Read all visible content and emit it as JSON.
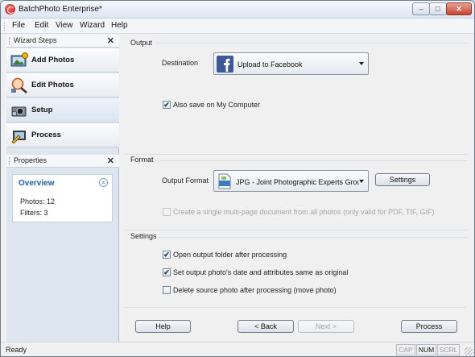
{
  "window": {
    "title": "BatchPhoto Enterprise*",
    "controls": {
      "minimize": "–",
      "maximize": "□",
      "close": "✕"
    }
  },
  "menu": [
    "File",
    "Edit",
    "View",
    "Wizard",
    "Help"
  ],
  "wizard_steps": {
    "title": "Wizard Steps",
    "close": "✕",
    "items": [
      {
        "label": "Add Photos",
        "icon": "add-photos-icon"
      },
      {
        "label": "Edit Photos",
        "icon": "edit-photos-icon"
      },
      {
        "label": "Setup",
        "icon": "setup-icon"
      },
      {
        "label": "Process",
        "icon": "process-icon"
      }
    ],
    "active": "Setup"
  },
  "properties": {
    "title": "Properties",
    "close": "✕",
    "overview": {
      "title": "Overview",
      "collapse": "»",
      "photos": "Photos: 12",
      "filters": "Filters: 3"
    }
  },
  "output": {
    "group_title": "Output",
    "destination_label": "Destination",
    "destination_value": "Upload to Facebook",
    "also_save_label": "Also save on My Computer",
    "also_save_checked": true
  },
  "format": {
    "group_title": "Format",
    "output_format_label": "Output Format",
    "output_format_value": "JPG - Joint Photographic Experts Group JF",
    "settings_button": "Settings",
    "multipage_label": "Create a single multi-page document from all photos (only valid for PDF, TIF, GIF)",
    "multipage_checked": false
  },
  "settings": {
    "group_title": "Settings",
    "open_folder_label": "Open output folder after processing",
    "open_folder_checked": true,
    "set_date_label": "Set output photo's date and attributes same as original",
    "set_date_checked": true,
    "delete_source_label": "Delete source photo after processing (move photo)",
    "delete_source_checked": false
  },
  "buttons": {
    "help": "Help",
    "back": "< Back",
    "next": "Next >",
    "process": "Process"
  },
  "statusbar": {
    "status": "Ready",
    "cap": "CAP",
    "num": "NUM",
    "scrl": "SCRL"
  },
  "check_glyph": "✔",
  "colors": {
    "accent": "#1a5faa",
    "facebook": "#3b5998",
    "close": "#c7442e"
  }
}
